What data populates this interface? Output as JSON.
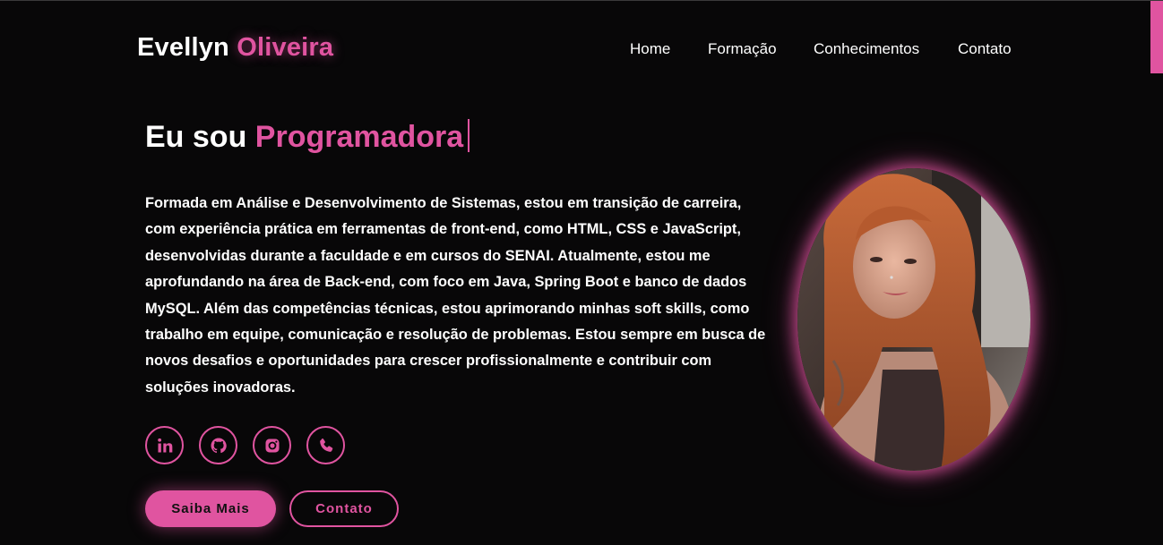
{
  "header": {
    "logo_first": "Evellyn",
    "logo_last": "Oliveira",
    "nav": [
      "Home",
      "Formação",
      "Conhecimentos",
      "Contato"
    ]
  },
  "hero": {
    "headline_prefix": "Eu sou",
    "headline_accent": "Programadora",
    "bio": "Formada em Análise e Desenvolvimento de Sistemas, estou em transição de carreira, com experiência prática em ferramentas de front-end, como HTML, CSS e JavaScript, desenvolvidas durante a faculdade e em cursos do SENAI. Atualmente, estou me aprofundando na área de Back-end, com foco em Java, Spring Boot e banco de dados MySQL. Além das competências técnicas, estou aprimorando minhas soft skills, como trabalho em equipe, comunicação e resolução de problemas. Estou sempre em busca de novos desafios e oportunidades para crescer profissionalmente e contribuir com soluções inovadoras.",
    "socials": [
      "linkedin-icon",
      "github-icon",
      "instagram-icon",
      "phone-icon"
    ],
    "primary_button": "Saiba Mais",
    "secondary_button": "Contato",
    "profile_photo": "profile-photo"
  },
  "colors": {
    "accent": "#e054a0",
    "background": "#080708",
    "text": "#ffffff"
  }
}
